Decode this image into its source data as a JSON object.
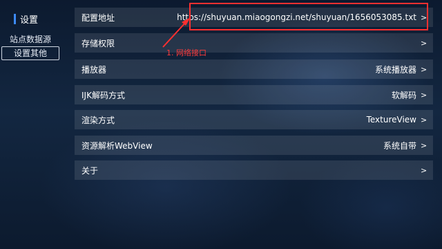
{
  "sidebar": {
    "title": "设置",
    "items": [
      {
        "label": "站点数据源",
        "selected": false
      },
      {
        "label": "设置其他",
        "selected": true
      }
    ]
  },
  "settings": [
    {
      "label": "配置地址",
      "value": "https://shuyuan.miaogongzi.net/shuyuan/1656053085.txt",
      "chevron": ">"
    },
    {
      "label": "存储权限",
      "value": "",
      "chevron": ">"
    },
    {
      "label": "播放器",
      "value": "系统播放器",
      "chevron": ">"
    },
    {
      "label": "IJK解码方式",
      "value": "软解码",
      "chevron": ">"
    },
    {
      "label": "渲染方式",
      "value": "TextureView",
      "chevron": ">"
    },
    {
      "label": "资源解析WebView",
      "value": "系统自带",
      "chevron": ">"
    },
    {
      "label": "关于",
      "value": "",
      "chevron": ">"
    }
  ],
  "annotation": {
    "label": "1. 网络接口",
    "color": "#ff3030"
  },
  "colors": {
    "accent": "#3d8bff",
    "row_background": "rgba(255,255,255,0.10)"
  }
}
